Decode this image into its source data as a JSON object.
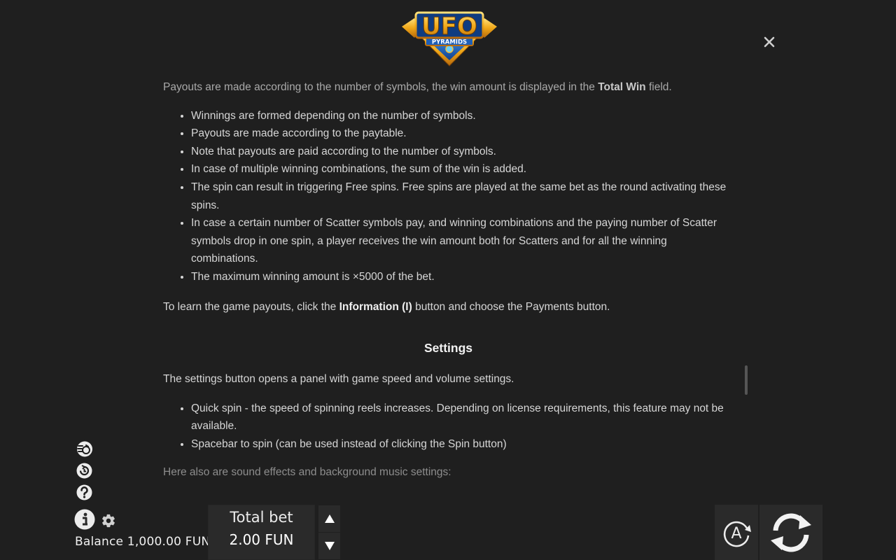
{
  "logo": {
    "title": "UFO",
    "subtitle": "PYRAMIDS"
  },
  "close": {
    "icon": "close-icon",
    "symbol": "✕"
  },
  "content": {
    "intro_before": "Payouts are made according to the number of symbols, the win amount is displayed in the ",
    "intro_bold": "Total Win",
    "intro_after": " field.",
    "payout_items": [
      "Winnings are formed depending on the number of symbols.",
      "Payouts are made according to the paytable.",
      "Note that payouts are paid according to the number of symbols.",
      "In case of multiple winning combinations, the sum of the win is added.",
      "The spin can result in triggering Free spins. Free spins are played at the same bet as the round activating these spins.",
      "In case a certain number of Scatter symbols pay, and winning combinations and the paying number of Scatter symbols drop in one spin, a player receives the win amount both for Scatters and for all the winning combinations.",
      "The maximum winning amount is ×5000 of the bet."
    ],
    "learn_before": "To learn the game payouts, click the ",
    "learn_bold": "Information (I)",
    "learn_after": " button and choose the Payments button.",
    "settings_heading": "Settings",
    "settings_desc": "The settings button opens a panel with game speed and volume settings.",
    "settings_items": [
      "Quick spin - the speed of spinning reels increases. Depending on license requirements, this feature may not be available.",
      "Spacebar to spin (can be used instead of clicking the Spin button)"
    ],
    "sound_text": "Here also are sound effects and background music settings:"
  },
  "footer": {
    "balance_text": "Balance 1,000.00 FUN",
    "total_bet_label": "Total bet",
    "total_bet_value": "2.00 FUN",
    "auto_label": "A"
  },
  "icons": {
    "turbo": "turbo-icon",
    "history": "history-icon",
    "help": "help-icon",
    "info": "info-icon",
    "settings": "gear-icon",
    "bet_up": "arrow-up-icon",
    "bet_down": "arrow-down-icon",
    "autoplay": "autoplay-icon",
    "spin": "spin-icon"
  },
  "colors": {
    "background": "#1f1f1f",
    "panel": "#2a2a2a",
    "text": "#d6d6d6",
    "logo_gold": "#e8a21a",
    "logo_blue": "#1d5fb8"
  }
}
